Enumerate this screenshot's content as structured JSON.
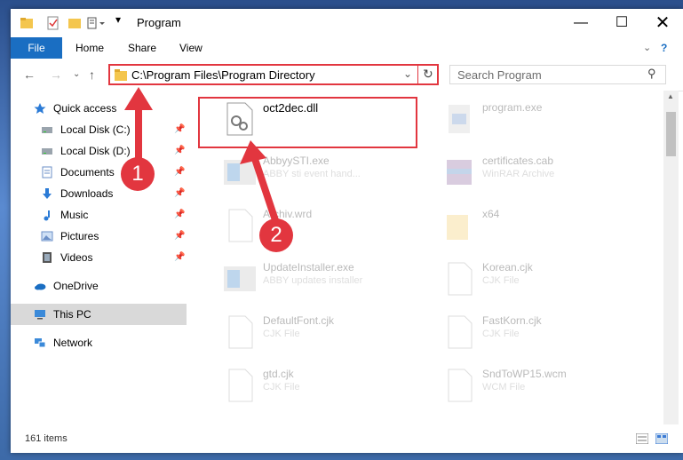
{
  "window": {
    "title": "Program"
  },
  "ribbon": {
    "tabs": [
      "File",
      "Home",
      "Share",
      "View"
    ]
  },
  "address": {
    "path": "C:\\Program Files\\Program Directory"
  },
  "search": {
    "placeholder": "Search Program"
  },
  "sidebar": {
    "items": [
      {
        "label": "Quick access",
        "icon": "star-icon"
      },
      {
        "label": "Local Disk (C:)",
        "icon": "drive-icon"
      },
      {
        "label": "Local Disk (D:)",
        "icon": "drive-icon"
      },
      {
        "label": "Documents",
        "icon": "documents-icon"
      },
      {
        "label": "Downloads",
        "icon": "download-icon"
      },
      {
        "label": "Music",
        "icon": "music-icon"
      },
      {
        "label": "Pictures",
        "icon": "pictures-icon"
      },
      {
        "label": "Videos",
        "icon": "videos-icon"
      },
      {
        "label": "OneDrive",
        "icon": "cloud-icon"
      },
      {
        "label": "This PC",
        "icon": "computer-icon"
      },
      {
        "label": "Network",
        "icon": "network-icon"
      }
    ]
  },
  "files": [
    {
      "name": "oct2dec.dll",
      "sub": ""
    },
    {
      "name": "program.exe",
      "sub": ""
    },
    {
      "name": "AbbyySTI.exe",
      "sub": "ABBY sti event hand..."
    },
    {
      "name": "certificates.cab",
      "sub": "WinRAR Archive"
    },
    {
      "name": "Archiv.wrd",
      "sub": ""
    },
    {
      "name": "x64",
      "sub": ""
    },
    {
      "name": "UpdateInstaller.exe",
      "sub": "ABBY updates installer"
    },
    {
      "name": "Korean.cjk",
      "sub": "CJK File"
    },
    {
      "name": "DefaultFont.cjk",
      "sub": "CJK File"
    },
    {
      "name": "FastKorn.cjk",
      "sub": "CJK File"
    },
    {
      "name": "gtd.cjk",
      "sub": "CJK File"
    },
    {
      "name": "SndToWP15.wcm",
      "sub": "WCM File"
    }
  ],
  "status": {
    "items": "161 items"
  },
  "annotations": {
    "step1": "1",
    "step2": "2"
  },
  "colors": {
    "accent": "#1a6ec2",
    "highlight": "#e2363f"
  }
}
